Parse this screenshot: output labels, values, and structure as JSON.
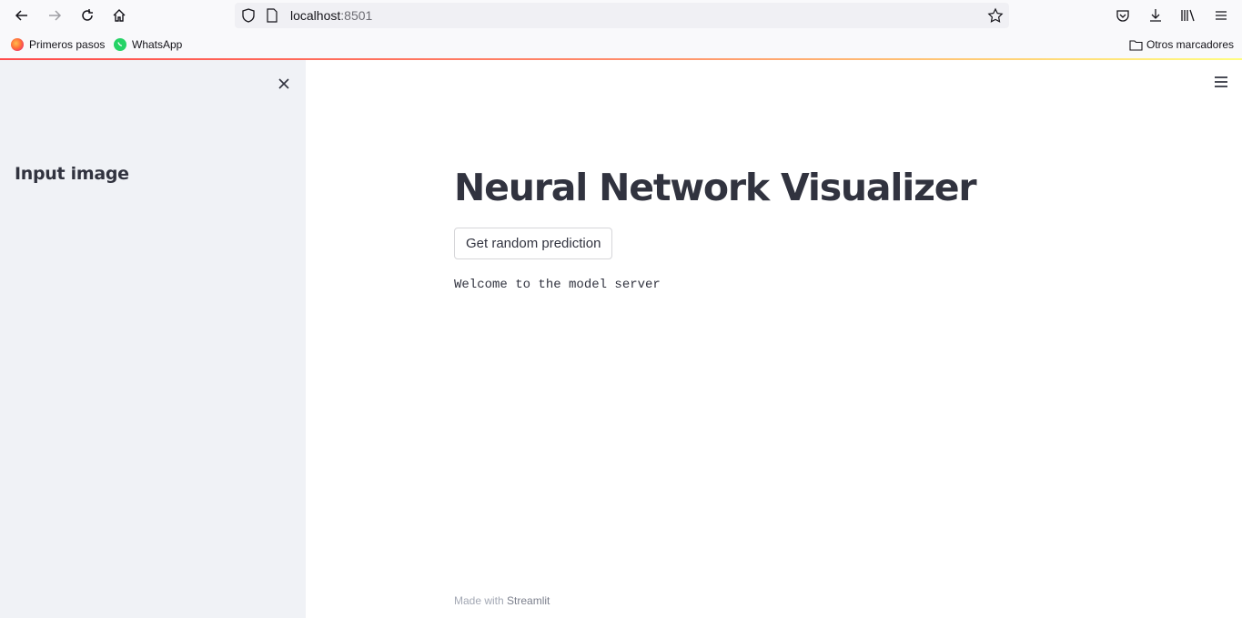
{
  "browser": {
    "url_host": "localhost",
    "url_port": ":8501",
    "bookmarks": [
      {
        "label": "Primeros pasos",
        "icon": "firefox-icon"
      },
      {
        "label": "WhatsApp",
        "icon": "whatsapp-icon"
      }
    ],
    "other_bookmarks": "Otros marcadores"
  },
  "sidebar": {
    "title": "Input image"
  },
  "main": {
    "title": "Neural Network Visualizer",
    "button_label": "Get random prediction",
    "message": "Welcome to the model server",
    "footer_prefix": "Made with ",
    "footer_brand": "Streamlit"
  },
  "colors": {
    "sidebar_bg": "#f0f2f6",
    "text": "#31333f",
    "accent": "#ff4b4b"
  }
}
